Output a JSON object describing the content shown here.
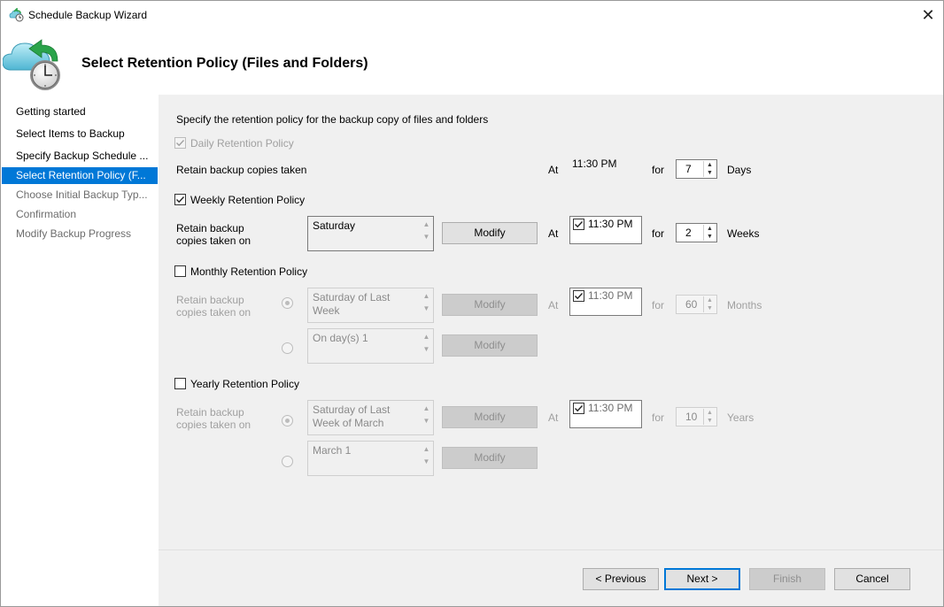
{
  "window": {
    "title": "Schedule Backup Wizard",
    "close_glyph": "✕"
  },
  "header": {
    "title": "Select Retention Policy (Files and Folders)",
    "icon": "backup-clock-icon"
  },
  "nav": {
    "items": [
      {
        "label": "Getting started",
        "state": "normal"
      },
      {
        "label": "Select Items to Backup",
        "state": "normal"
      },
      {
        "label": "Specify Backup Schedule ...",
        "state": "normal"
      },
      {
        "label": "Select Retention Policy (F...",
        "state": "active"
      },
      {
        "label": "Choose Initial Backup Typ...",
        "state": "disabled"
      },
      {
        "label": "Confirmation",
        "state": "disabled"
      },
      {
        "label": "Modify Backup Progress",
        "state": "disabled"
      }
    ]
  },
  "content": {
    "intro": "Specify the retention policy for the backup copy of files and folders",
    "daily": {
      "label": "Daily Retention Policy",
      "checked": true,
      "enabled": false,
      "retain_label": "Retain backup copies taken",
      "at_label": "At",
      "time": "11:30 PM",
      "for_label": "for",
      "count": "7",
      "unit": "Days"
    },
    "weekly": {
      "label": "Weekly Retention Policy",
      "checked": true,
      "retain_label_1": "Retain backup",
      "retain_label_2": "copies taken on",
      "selection": "Saturday",
      "modify": "Modify",
      "at_label": "At",
      "time": "11:30 PM",
      "for_label": "for",
      "count": "2",
      "unit": "Weeks"
    },
    "monthly": {
      "label": "Monthly Retention Policy",
      "checked": false,
      "retain_label_1": "Retain backup",
      "retain_label_2": "copies taken on",
      "option1_line1": "Saturday of Last",
      "option1_line2": "Week",
      "option2": "On day(s) 1",
      "modify": "Modify",
      "at_label": "At",
      "time": "11:30 PM",
      "for_label": "for",
      "count": "60",
      "unit": "Months"
    },
    "yearly": {
      "label": "Yearly Retention Policy",
      "checked": false,
      "retain_label_1": "Retain backup",
      "retain_label_2": "copies taken on",
      "option1_line1": "Saturday of Last",
      "option1_line2": "Week of March",
      "option2": "March 1",
      "modify": "Modify",
      "at_label": "At",
      "time": "11:30 PM",
      "for_label": "for",
      "count": "10",
      "unit": "Years"
    }
  },
  "footer": {
    "previous": "< Previous",
    "next": "Next >",
    "finish": "Finish",
    "cancel": "Cancel"
  },
  "colors": {
    "accent": "#0078d7",
    "panel": "#f0f0f0",
    "disabled_text": "#a0a0a0"
  }
}
